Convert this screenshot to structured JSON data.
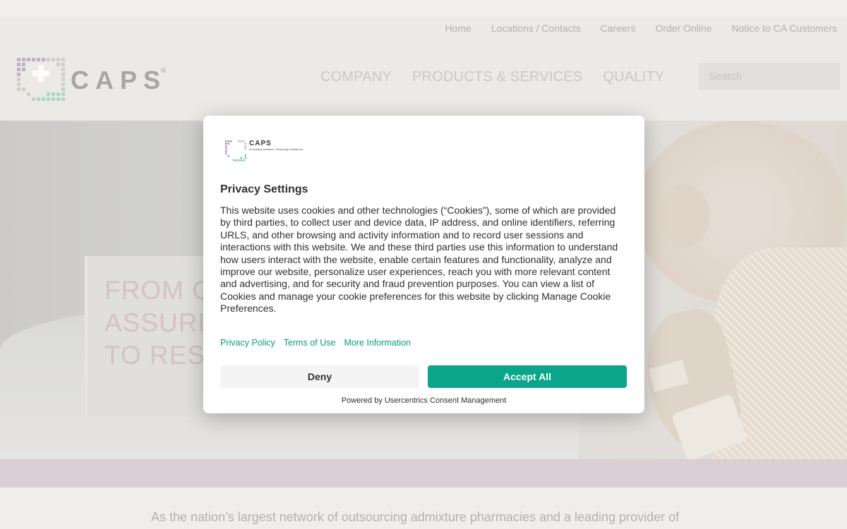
{
  "utility_nav": [
    "Home",
    "Locations / Contacts",
    "Careers",
    "Order Online",
    "Notice to CA Customers"
  ],
  "brand": {
    "name": "CAPS",
    "registered": "®"
  },
  "main_nav": [
    "COMPANY",
    "PRODUCTS & SERVICES",
    "QUALITY"
  ],
  "search": {
    "placeholder": "Search"
  },
  "hero": {
    "lines": [
      "FROM QUALITY",
      "ASSURED",
      "TO RESTORED"
    ]
  },
  "intro_text": "As the nation’s largest network of outsourcing admixture pharmacies and a leading provider of",
  "consent": {
    "logo_name": "CAPS",
    "logo_tagline": "Innovating solutions. Delivering confidence.",
    "title": "Privacy Settings",
    "body": "This website uses cookies and other technologies (“Cookies”), some of which are provided by third parties, to collect user and device data, IP address, and online identifiers, referring URLS, and other browsing and activity information and to record user sessions and interactions with this website. We and these third parties use this information to understand how users interact with the website, enable certain features and functionality, analyze and improve our website, personalize user experiences, reach you with more relevant content and advertising, and for security and fraud prevention purposes. You can view a list of Cookies and manage your cookie preferences for this website by clicking Manage Cookie Preferences.",
    "links": [
      "Privacy Policy",
      "Terms of Use",
      "More Information"
    ],
    "deny_label": "Deny",
    "accept_label": "Accept All",
    "powered_by": "Powered by Usercentrics Consent Management"
  },
  "colors": {
    "accent": "#0aa58b",
    "link": "#0a9b84"
  }
}
